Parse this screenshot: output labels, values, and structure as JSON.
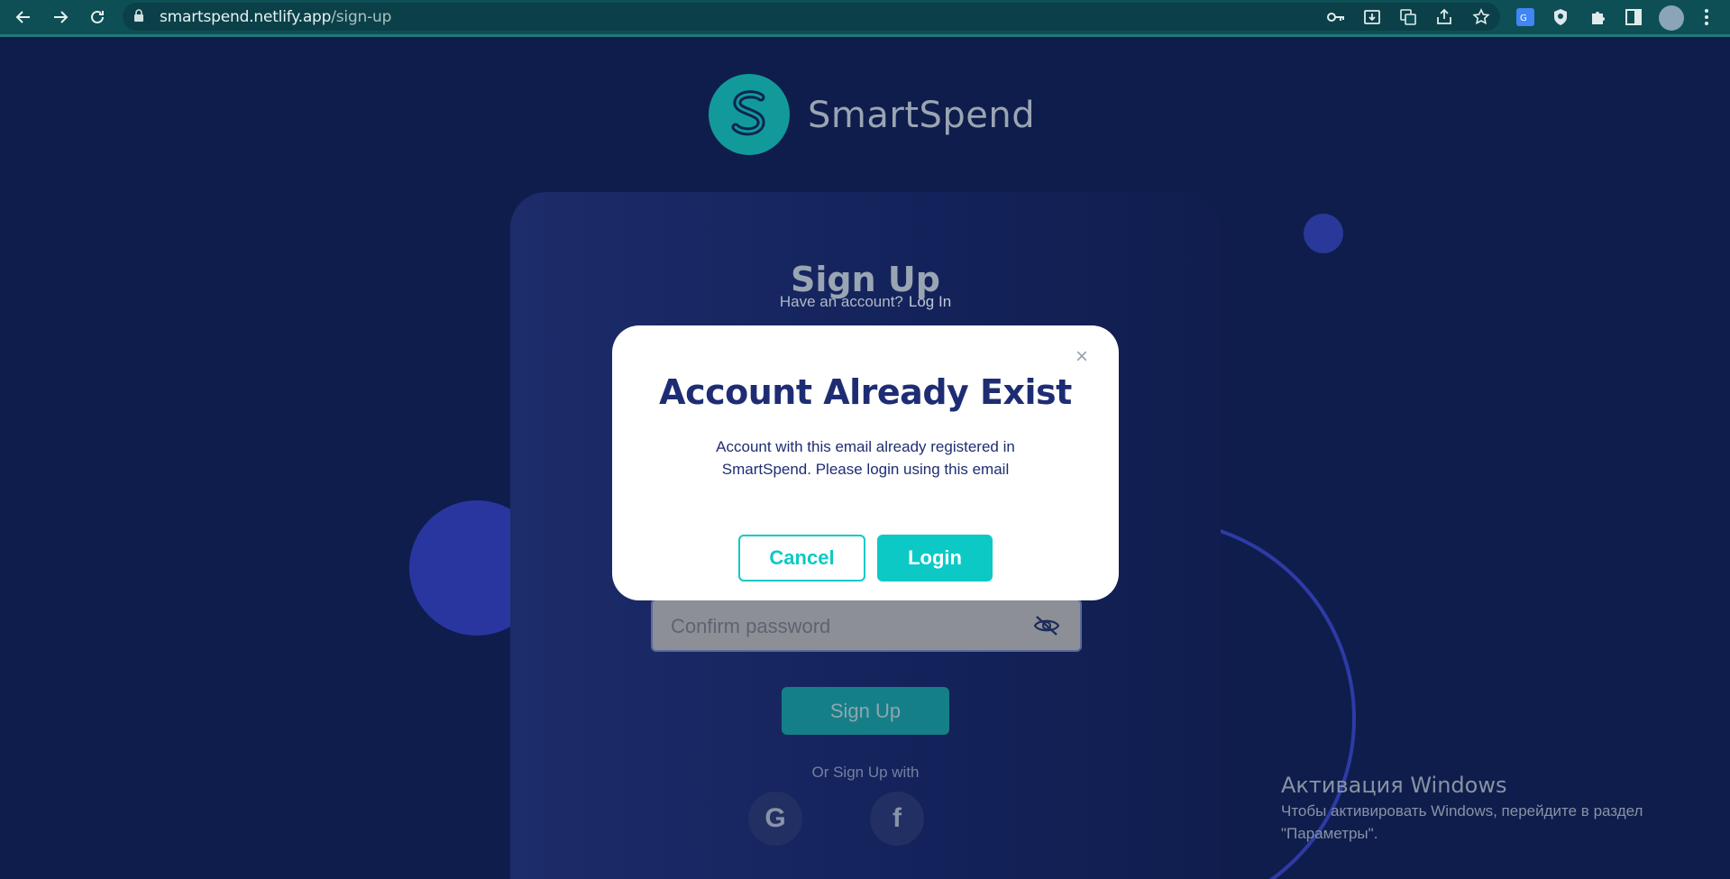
{
  "browser": {
    "url_host": "smartspend.netlify.app",
    "url_path": "/sign-up",
    "icons": [
      "back-arrow-icon",
      "forward-arrow-icon",
      "reload-icon",
      "lock-icon",
      "key-icon",
      "install-icon",
      "translate-icon",
      "share-icon",
      "star-icon",
      "google-translate-icon",
      "shield-extension-icon",
      "puzzle-icon",
      "side-panel-icon",
      "profile-avatar",
      "menu-kebab-icon"
    ]
  },
  "brand": {
    "name": "SmartSpend",
    "logo_color": "#129a9b"
  },
  "signup_card": {
    "title": "Sign Up",
    "have_account": "Have an account?",
    "login_link": "Log In",
    "confirm_password_placeholder": "Confirm password",
    "signup_button": "Sign Up",
    "or_text": "Or Sign Up with",
    "social": [
      {
        "label": "G",
        "icon": "google-icon"
      },
      {
        "label": "f",
        "icon": "facebook-icon"
      }
    ]
  },
  "modal": {
    "title": "Account Already Exist",
    "message": "Account with this email already registered in SmartSpend. Please login using this email",
    "cancel_label": "Cancel",
    "login_label": "Login",
    "close_symbol": "×",
    "accent_color": "#0dc9c6",
    "title_color": "#1e2d73"
  },
  "windows_watermark": {
    "title": "Активация Windows",
    "line1": "Чтобы активировать Windows, перейдите в раздел",
    "line2": "\"Параметры\"."
  }
}
